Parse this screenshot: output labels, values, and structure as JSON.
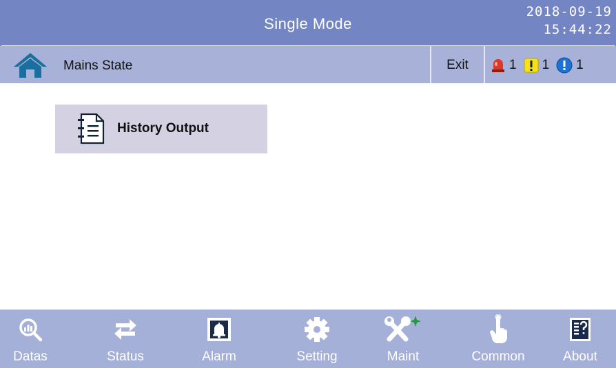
{
  "header": {
    "title": "Single Mode",
    "date": "2018-09-19",
    "time": "15:44:22"
  },
  "subbar": {
    "page_label": "Mains State",
    "exit_label": "Exit",
    "alarms": [
      {
        "icon": "red-alarm-icon",
        "count": "1"
      },
      {
        "icon": "yellow-warning-icon",
        "count": "1"
      },
      {
        "icon": "blue-info-icon",
        "count": "1"
      }
    ]
  },
  "main": {
    "items": [
      {
        "label": "History Output",
        "icon": "document-list-icon"
      }
    ]
  },
  "nav": {
    "items": [
      {
        "label": "Datas",
        "icon": "magnifier-chart-icon"
      },
      {
        "label": "Status",
        "icon": "swap-arrows-icon"
      },
      {
        "label": "Alarm",
        "icon": "bell-icon"
      },
      {
        "label": "Setting",
        "icon": "gear-icon"
      },
      {
        "label": "Maint",
        "icon": "tools-icon"
      },
      {
        "label": "Common",
        "icon": "pointing-hand-icon"
      },
      {
        "label": "About",
        "icon": "info-sheet-icon"
      }
    ]
  },
  "colors": {
    "title_bar": "#7485c3",
    "sub_bar": "#a8b1d8",
    "bottom_bar": "#a4b0d8",
    "menu_card": "#d4d2e2"
  }
}
